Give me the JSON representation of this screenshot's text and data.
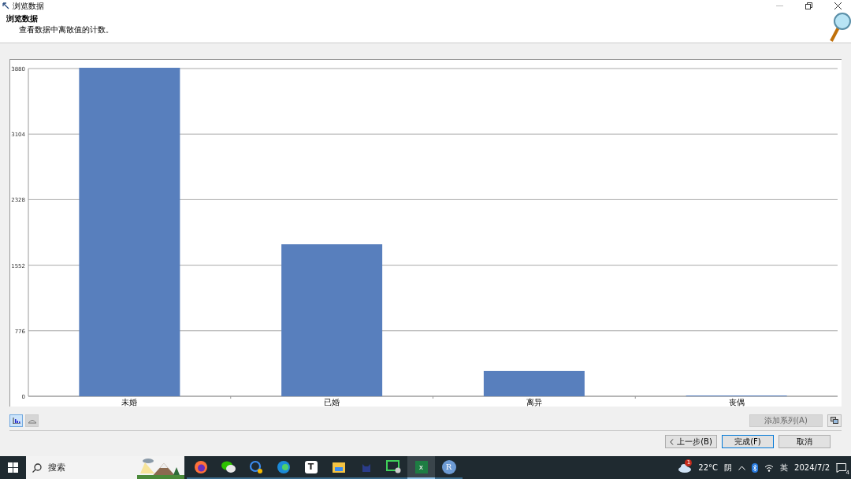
{
  "window": {
    "title": "浏览数据"
  },
  "header": {
    "title": "浏览数据",
    "subtitle": "查看数据中离散值的计数。"
  },
  "chart_data": {
    "type": "bar",
    "categories": [
      "未婚",
      "已婚",
      "离异",
      "丧偶"
    ],
    "values": [
      3880,
      1790,
      290,
      0
    ],
    "grid": true,
    "ylim": [
      0,
      3880
    ],
    "yticks": [
      0,
      776,
      1552,
      2328,
      3104,
      3880
    ]
  },
  "view_toggles": [
    {
      "kind": "bar",
      "selected": true
    },
    {
      "kind": "area",
      "selected": false
    }
  ],
  "add_series": {
    "label": "添加系列(A)",
    "disabled": true
  },
  "buttons": [
    {
      "label": "上一步(B)",
      "kind": "back",
      "default": false
    },
    {
      "label": "完成(F)",
      "kind": "finish",
      "default": true
    },
    {
      "label": "取消",
      "kind": "cancel",
      "default": false
    }
  ],
  "taskbar": {
    "search": {
      "placeholder": "搜索"
    },
    "apps": [
      {
        "kind": "firefox",
        "active": false
      },
      {
        "kind": "chat",
        "active": false
      },
      {
        "kind": "search",
        "active": false
      },
      {
        "kind": "edge",
        "active": false
      },
      {
        "kind": "letter",
        "label": "T",
        "active": false
      },
      {
        "kind": "folder",
        "active": false
      },
      {
        "kind": "cat",
        "active": false
      },
      {
        "kind": "remote",
        "active": false
      },
      {
        "kind": "excel",
        "label": "x",
        "active": true
      },
      {
        "kind": "letter-round",
        "label": "R",
        "active": false
      }
    ],
    "weather": {
      "badge": "1",
      "temperature": "22°C",
      "condition": "阴"
    },
    "ime": "英",
    "date": "2024/7/2",
    "notifications": "4"
  }
}
